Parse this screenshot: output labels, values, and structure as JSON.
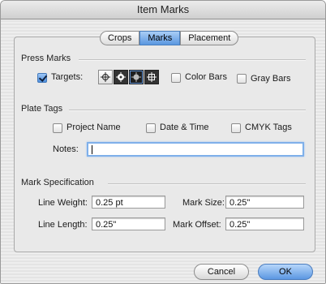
{
  "window": {
    "title": "Item Marks"
  },
  "tabs": [
    {
      "label": "Crops",
      "selected": false
    },
    {
      "label": "Marks",
      "selected": true
    },
    {
      "label": "Placement",
      "selected": false
    }
  ],
  "press_marks": {
    "heading": "Press Marks",
    "targets_label": "Targets:",
    "targets_checked": true,
    "target_icons": [
      "crosshair-target-icon",
      "crosshair-target-dark-icon",
      "solid-target-dark-icon",
      "crosshair-target-dark-icon"
    ],
    "selected_target": 2,
    "color_bars_label": "Color Bars",
    "color_bars_checked": false,
    "gray_bars_label": "Gray Bars",
    "gray_bars_checked": false
  },
  "plate_tags": {
    "heading": "Plate Tags",
    "project_name_label": "Project Name",
    "project_name_checked": false,
    "date_time_label": "Date & Time",
    "date_time_checked": false,
    "cmyk_tags_label": "CMYK Tags",
    "cmyk_tags_checked": false,
    "notes_label": "Notes:",
    "notes_value": ""
  },
  "mark_spec": {
    "heading": "Mark Specification",
    "line_weight_label": "Line Weight:",
    "line_weight_value": "0.25 pt",
    "mark_size_label": "Mark Size:",
    "mark_size_value": "0.25\"",
    "line_length_label": "Line Length:",
    "line_length_value": "0.25\"",
    "mark_offset_label": "Mark Offset:",
    "mark_offset_value": "0.25\""
  },
  "buttons": {
    "cancel": "Cancel",
    "ok": "OK"
  },
  "colors": {
    "accent": "#5a97e0",
    "focus_ring": "#7fb0ea"
  }
}
